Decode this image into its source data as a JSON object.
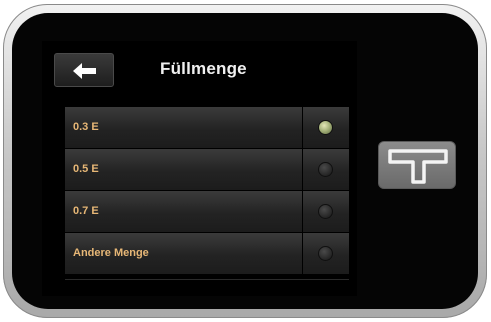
{
  "header": {
    "title": "Füllmenge",
    "back_icon": "arrow-left-icon"
  },
  "options": [
    {
      "label": "0.3 E",
      "selected": true
    },
    {
      "label": "0.5 E",
      "selected": false
    },
    {
      "label": "0.7 E",
      "selected": false
    },
    {
      "label": "Andere Menge",
      "selected": false
    }
  ],
  "hardware": {
    "home_button_icon": "t-logo-icon"
  },
  "colors": {
    "option_text": "#e7b776",
    "title_text": "#f0f0f0",
    "selected_radio": "#a7b37c",
    "screen_background": "#000000"
  }
}
